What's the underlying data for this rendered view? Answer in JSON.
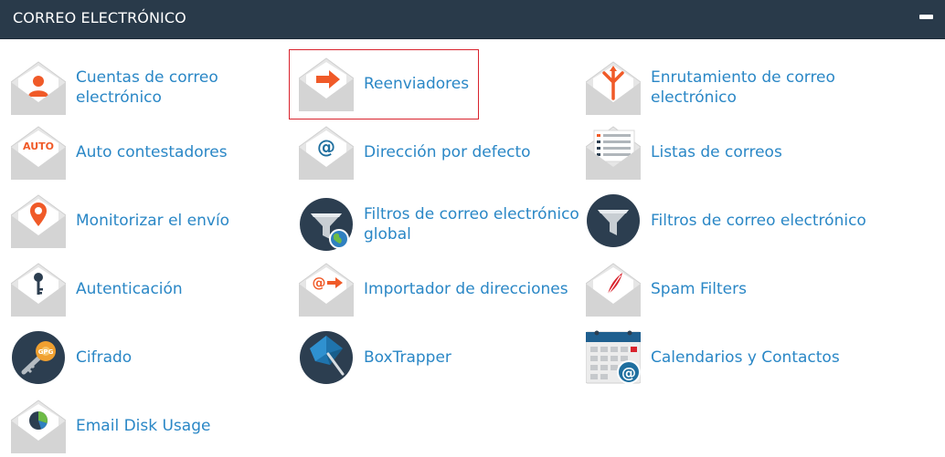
{
  "panel": {
    "title": "CORREO ELECTRÓNICO",
    "collapse_icon": "minus-icon"
  },
  "colors": {
    "header_bg": "#293a4a",
    "link": "#2a87c6",
    "accent_orange": "#f05a28",
    "selection_border": "#d9232d",
    "envelope_gray": "#e0e0e0",
    "dark_circle": "#2c3e50"
  },
  "items": [
    {
      "label_line1": "Cuentas de correo",
      "label_line2": "electrónico",
      "icon": "email-accounts-icon"
    },
    {
      "label": "Reenviadores",
      "icon": "forwarders-icon",
      "selected": true
    },
    {
      "label_line1": "Enrutamiento de correo",
      "label_line2": "electrónico",
      "icon": "email-routing-icon"
    },
    {
      "label": "Auto contestadores",
      "icon": "autoresponders-icon",
      "badge": "AUTO"
    },
    {
      "label": "Dirección por defecto",
      "icon": "default-address-icon",
      "badge": "@"
    },
    {
      "label": "Listas de correos",
      "icon": "mailing-lists-icon"
    },
    {
      "label": "Monitorizar el envío",
      "icon": "track-delivery-icon"
    },
    {
      "label_line1": "Filtros de correo electrónico",
      "label_line2": "global",
      "icon": "global-email-filters-icon"
    },
    {
      "label": "Filtros de correo electrónico",
      "icon": "email-filters-icon"
    },
    {
      "label": "Autenticación",
      "icon": "authentication-icon"
    },
    {
      "label": "Importador de direcciones",
      "icon": "address-importer-icon",
      "badge": "@"
    },
    {
      "label": "Spam Filters",
      "icon": "spam-filters-icon"
    },
    {
      "label": "Cifrado",
      "icon": "encryption-icon",
      "badge": "GPG"
    },
    {
      "label": "BoxTrapper",
      "icon": "boxtrapper-icon"
    },
    {
      "label": "Calendarios y Contactos",
      "icon": "calendars-contacts-icon",
      "badge": "@"
    },
    {
      "label": "Email Disk Usage",
      "icon": "email-disk-usage-icon"
    }
  ]
}
